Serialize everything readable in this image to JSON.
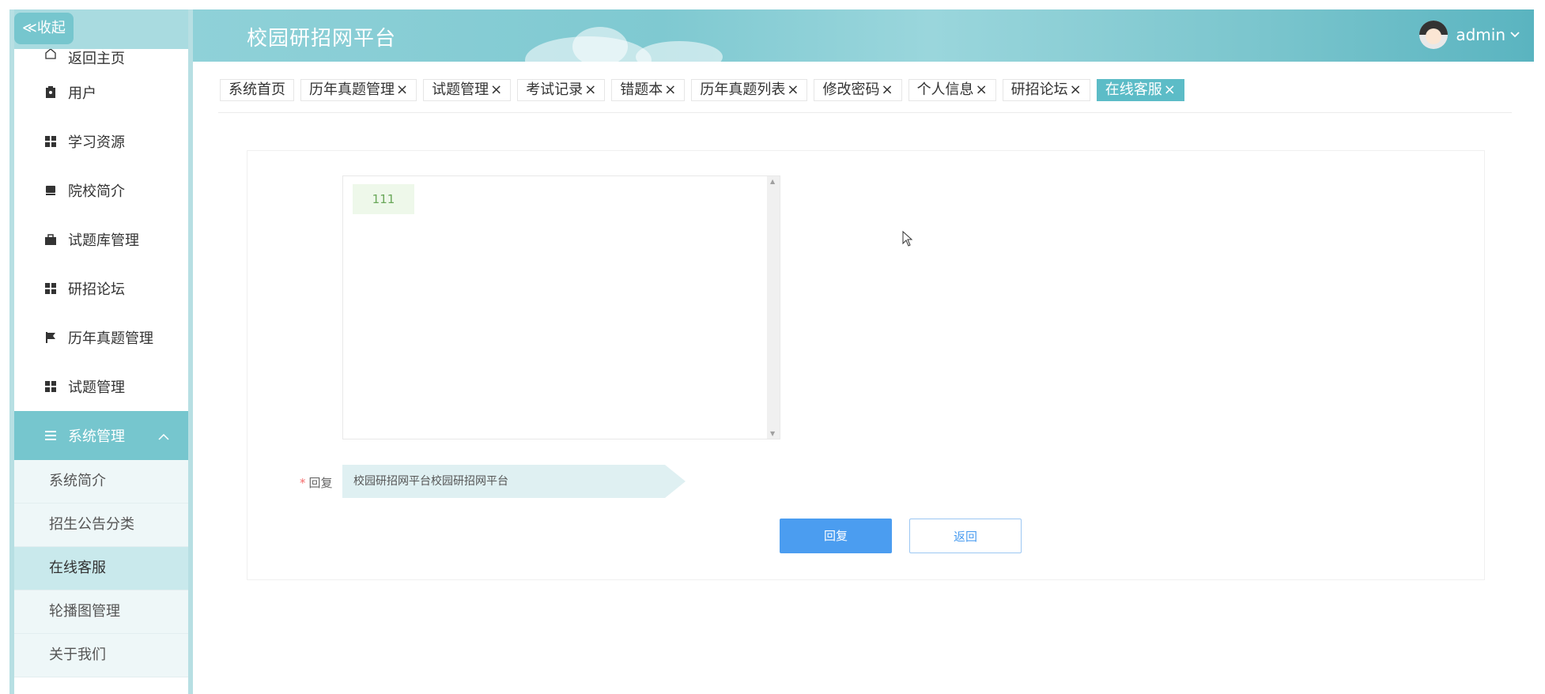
{
  "sidebar": {
    "collapse_label": "≪收起",
    "items": [
      {
        "label": "返回主页",
        "icon": "home-icon"
      },
      {
        "label": "用户",
        "icon": "user-badge-icon"
      },
      {
        "label": "学习资源",
        "icon": "grid-icon"
      },
      {
        "label": "院校简介",
        "icon": "book-icon"
      },
      {
        "label": "试题库管理",
        "icon": "briefcase-icon"
      },
      {
        "label": "研招论坛",
        "icon": "grid-icon"
      },
      {
        "label": "历年真题管理",
        "icon": "flag-icon"
      },
      {
        "label": "试题管理",
        "icon": "grid-icon"
      }
    ],
    "group": {
      "label": "系统管理",
      "icon": "list-icon"
    },
    "sub_items": [
      {
        "label": "系统简介"
      },
      {
        "label": "招生公告分类"
      },
      {
        "label": "在线客服"
      },
      {
        "label": "轮播图管理"
      },
      {
        "label": "关于我们"
      }
    ]
  },
  "header": {
    "title": "校园研招网平台",
    "user": "admin"
  },
  "tabs": [
    {
      "label": "系统首页",
      "closable": false
    },
    {
      "label": "历年真题管理",
      "closable": true
    },
    {
      "label": "试题管理",
      "closable": true
    },
    {
      "label": "考试记录",
      "closable": true
    },
    {
      "label": "错题本",
      "closable": true
    },
    {
      "label": "历年真题列表",
      "closable": true
    },
    {
      "label": "修改密码",
      "closable": true
    },
    {
      "label": "个人信息",
      "closable": true
    },
    {
      "label": "研招论坛",
      "closable": true
    },
    {
      "label": "在线客服",
      "closable": true,
      "active": true
    }
  ],
  "chat": {
    "messages": [
      {
        "text": "111"
      }
    ]
  },
  "form": {
    "reply_label": "回复",
    "required_mark": "*",
    "reply_value": "校园研招网平台校园研招网平台",
    "submit_label": "回复",
    "back_label": "返回"
  },
  "colors": {
    "accent": "#76c6ce",
    "active_tab": "#5cbcc7",
    "primary_button": "#4b9df0"
  }
}
